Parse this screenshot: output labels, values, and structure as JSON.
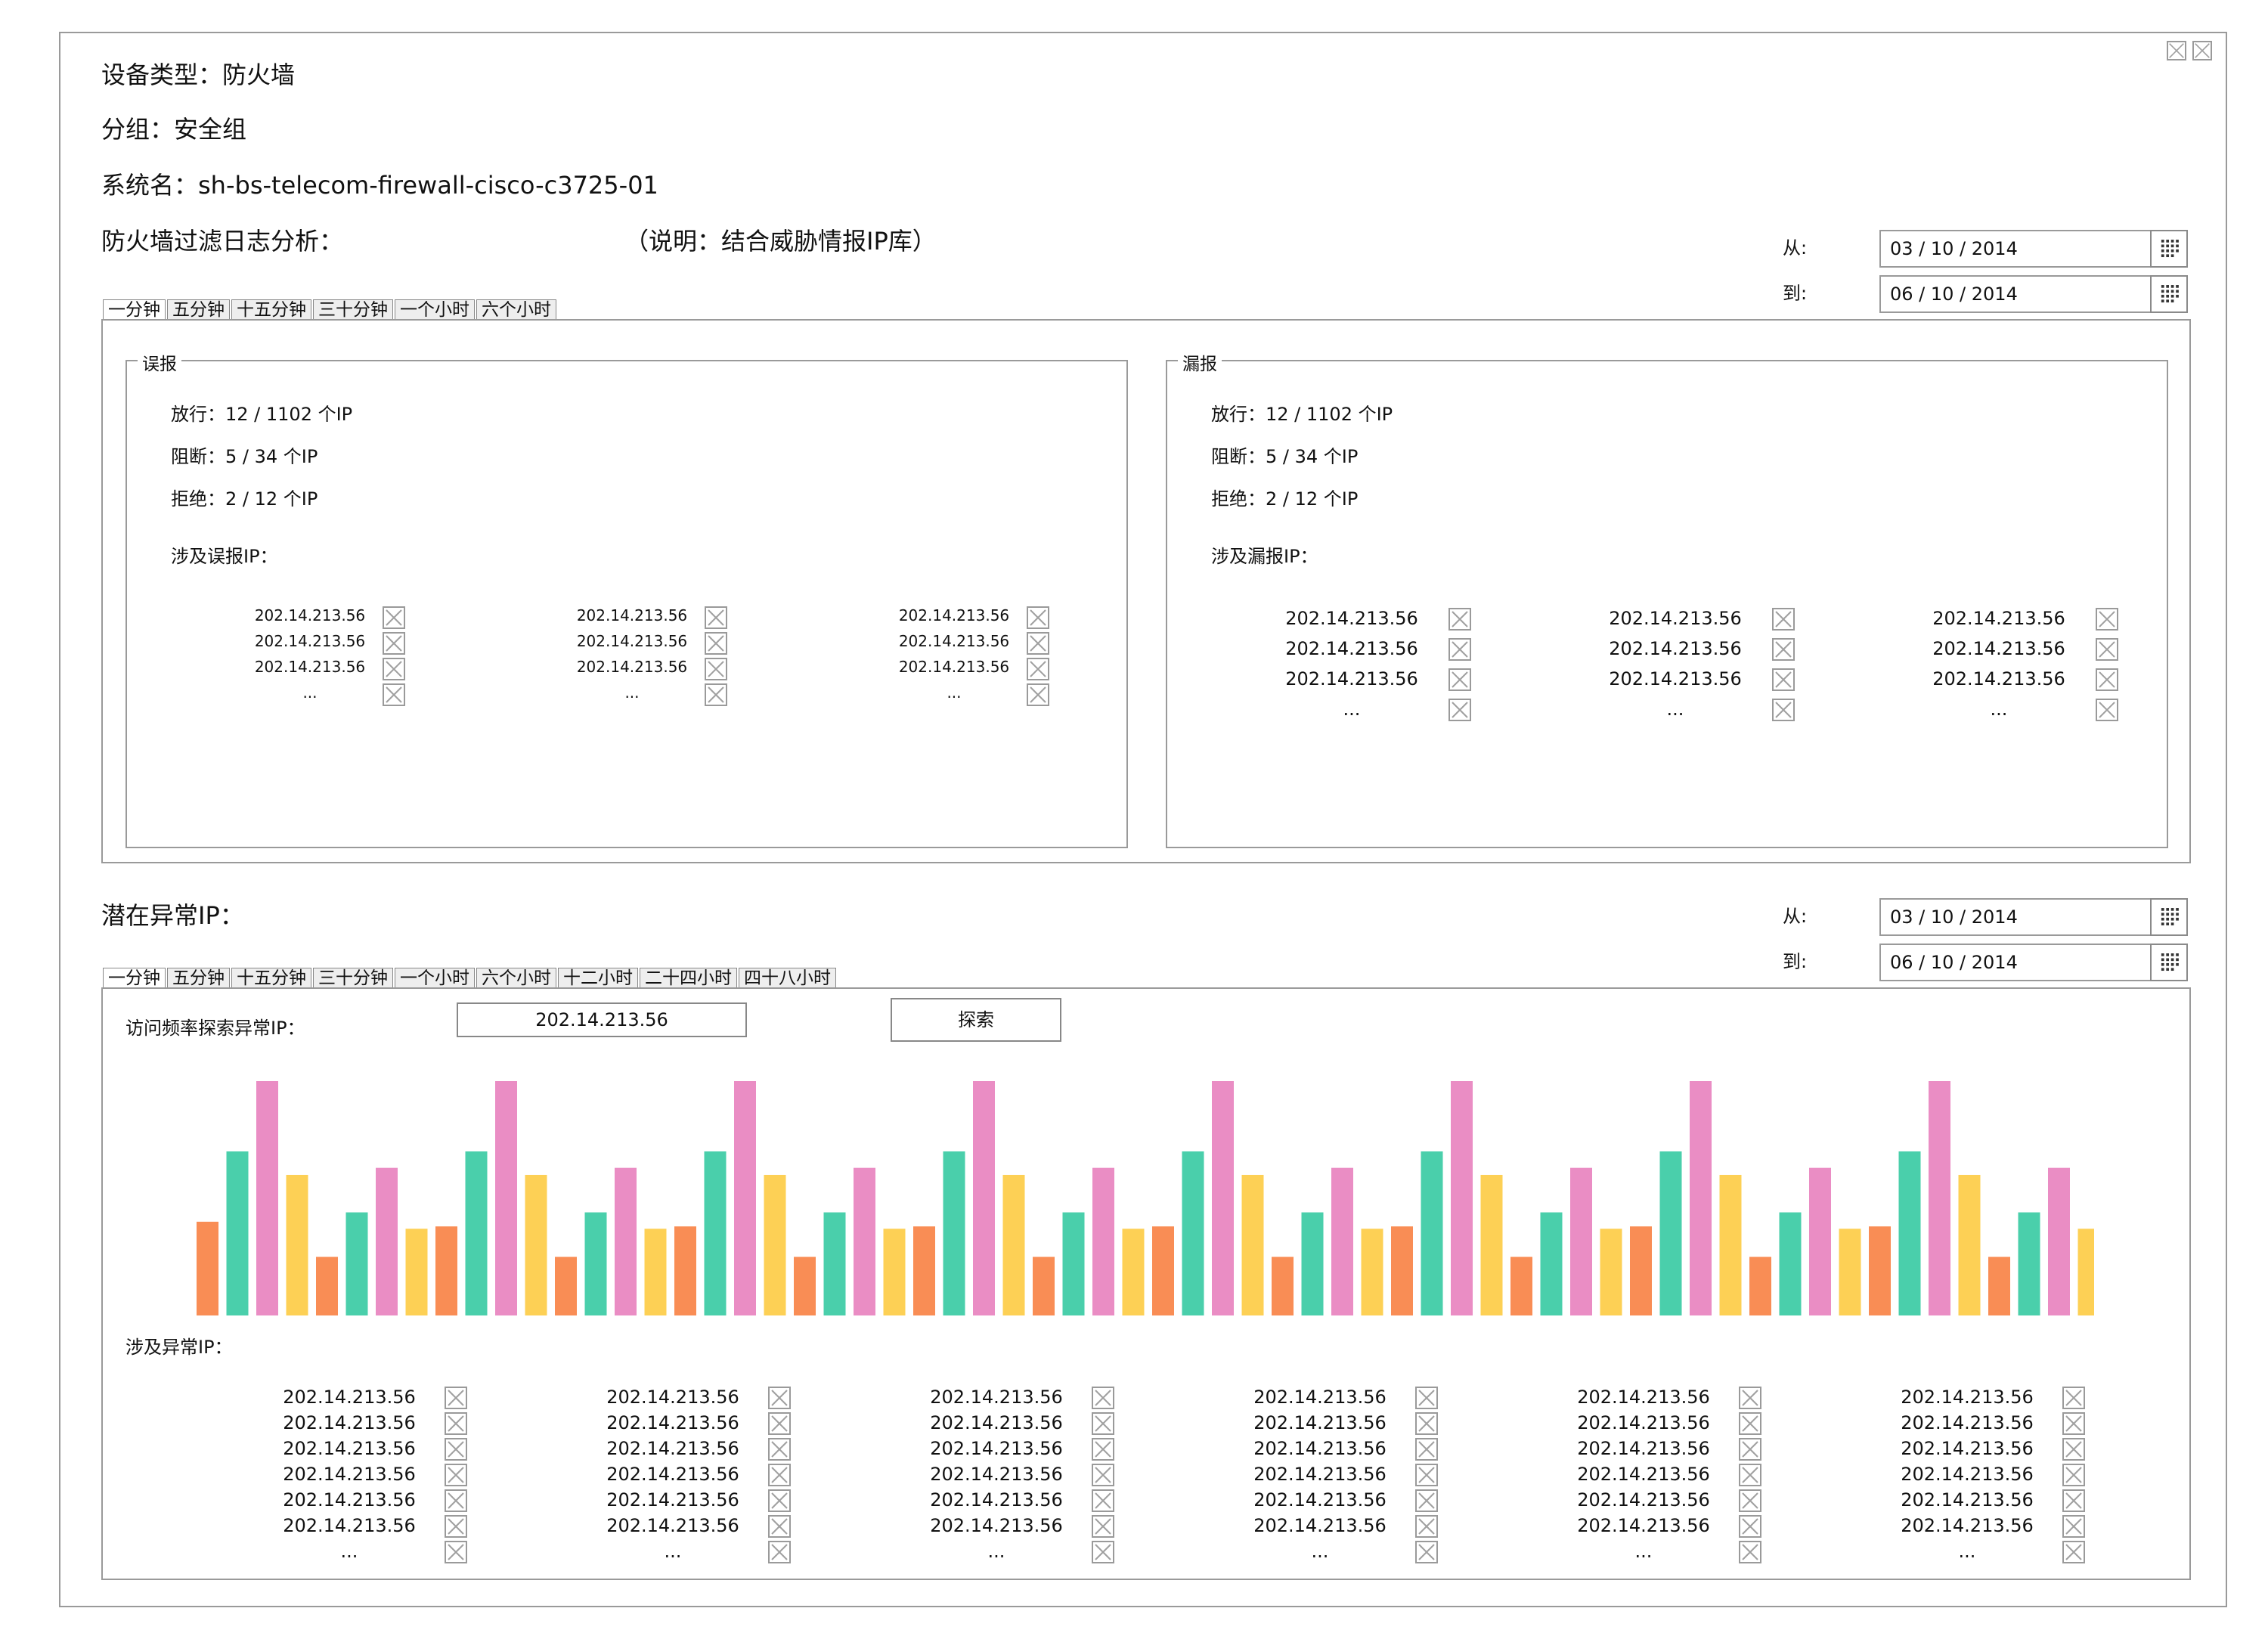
{
  "header": {
    "device_type": "设备类型：防火墙",
    "group": "分组：安全组",
    "system_name": "系统名：sh-bs-telecom-firewall-cisco-c3725-01",
    "analysis_title": "防火墙过滤日志分析：",
    "analysis_note": "（说明：结合威胁情报IP库）"
  },
  "date_range_1": {
    "from_label": "从:",
    "to_label": "到:",
    "from_value": "03 / 10 / 2014",
    "to_value": "06 / 10 / 2014"
  },
  "tabs_1": [
    "一分钟",
    "五分钟",
    "十五分钟",
    "三十分钟",
    "一个小时",
    "六个小时"
  ],
  "false_positive": {
    "legend": "误报",
    "pass": "放行：12 / 1102 个IP",
    "block": "阻断：5 / 34 个IP",
    "reject": "拒绝：2 / 12 个IP",
    "ip_label": "涉及误报IP：",
    "columns": [
      [
        "202.14.213.56",
        "202.14.213.56",
        "202.14.213.56",
        "..."
      ],
      [
        "202.14.213.56",
        "202.14.213.56",
        "202.14.213.56",
        "..."
      ],
      [
        "202.14.213.56",
        "202.14.213.56",
        "202.14.213.56",
        "..."
      ]
    ]
  },
  "false_negative": {
    "legend": "漏报",
    "pass": "放行：12 / 1102 个IP",
    "block": "阻断：5 / 34 个IP",
    "reject": "拒绝：2 / 12 个IP",
    "ip_label": "涉及漏报IP：",
    "columns": [
      [
        "202.14.213.56",
        "202.14.213.56",
        "202.14.213.56",
        "..."
      ],
      [
        "202.14.213.56",
        "202.14.213.56",
        "202.14.213.56",
        "..."
      ],
      [
        "202.14.213.56",
        "202.14.213.56",
        "202.14.213.56",
        "..."
      ]
    ]
  },
  "anomaly": {
    "title": "潜在异常IP：",
    "search_label": "访问频率探索异常IP：",
    "search_value": "202.14.213.56",
    "search_button": "探索",
    "ip_label": "涉及异常IP：",
    "columns": [
      [
        "202.14.213.56",
        "202.14.213.56",
        "202.14.213.56",
        "202.14.213.56",
        "202.14.213.56",
        "202.14.213.56",
        "..."
      ],
      [
        "202.14.213.56",
        "202.14.213.56",
        "202.14.213.56",
        "202.14.213.56",
        "202.14.213.56",
        "202.14.213.56",
        "..."
      ],
      [
        "202.14.213.56",
        "202.14.213.56",
        "202.14.213.56",
        "202.14.213.56",
        "202.14.213.56",
        "202.14.213.56",
        "..."
      ],
      [
        "202.14.213.56",
        "202.14.213.56",
        "202.14.213.56",
        "202.14.213.56",
        "202.14.213.56",
        "202.14.213.56",
        "..."
      ],
      [
        "202.14.213.56",
        "202.14.213.56",
        "202.14.213.56",
        "202.14.213.56",
        "202.14.213.56",
        "202.14.213.56",
        "..."
      ],
      [
        "202.14.213.56",
        "202.14.213.56",
        "202.14.213.56",
        "202.14.213.56",
        "202.14.213.56",
        "202.14.213.56",
        "..."
      ]
    ]
  },
  "date_range_2": {
    "from_label": "从:",
    "to_label": "到:",
    "from_value": "03 / 10 / 2014",
    "to_value": "06 / 10 / 2014"
  },
  "tabs_2": [
    "一分钟",
    "五分钟",
    "十五分钟",
    "三十分钟",
    "一个小时",
    "六个小时",
    "十二小时",
    "二十四小时",
    "四十八小时"
  ],
  "colors": {
    "orange": "#f98d55",
    "green": "#4acfab",
    "pink": "#ea8dc4",
    "yellow": "#fdd055"
  },
  "chart_data": {
    "type": "bar",
    "title": "",
    "xlabel": "",
    "ylabel": "",
    "ylim": [
      0,
      100
    ],
    "values": [
      40,
      70,
      100,
      60,
      25,
      44,
      63,
      37,
      38,
      70,
      100,
      60,
      25,
      44,
      63,
      37,
      38,
      70,
      100,
      60,
      25,
      44,
      63,
      37,
      38,
      70,
      100,
      60,
      25,
      44,
      63,
      37,
      38,
      70,
      100,
      60,
      25,
      44,
      63,
      37,
      38,
      70,
      100,
      60,
      25,
      44,
      63,
      37,
      38,
      70,
      100,
      60,
      25,
      44,
      63,
      37,
      38,
      70,
      100,
      60,
      25,
      44,
      63,
      37
    ],
    "color_pattern": [
      "orange",
      "green",
      "pink",
      "yellow",
      "orange",
      "green",
      "pink",
      "yellow"
    ]
  }
}
